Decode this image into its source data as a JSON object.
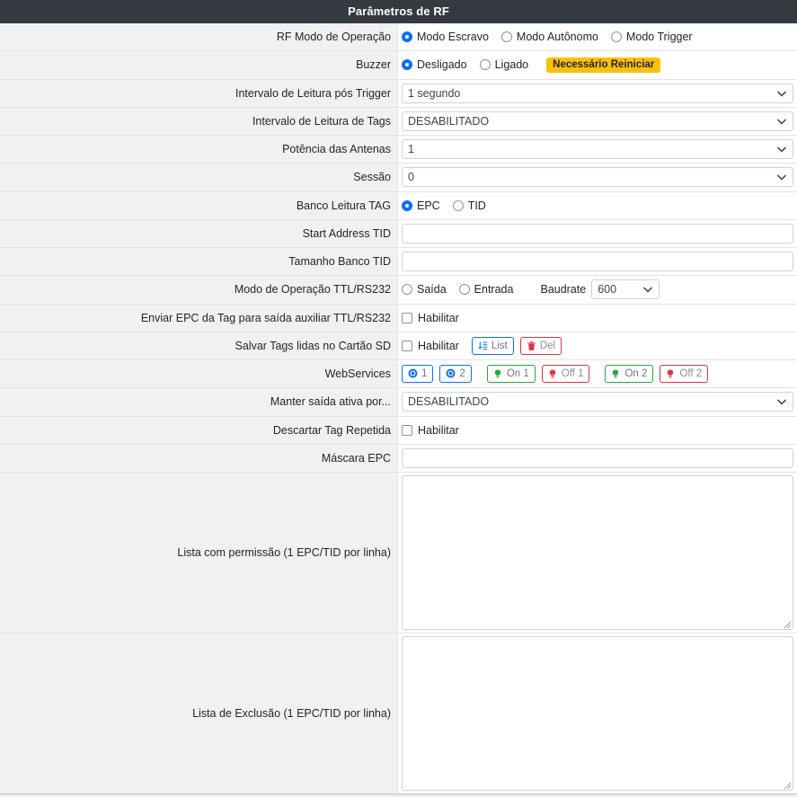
{
  "panel": {
    "title": "Parâmetros de RF",
    "header_bg": "#343a40"
  },
  "colors": {
    "accent_blue": "#0d6efd",
    "danger_red": "#dc3545",
    "success_green": "#28a745",
    "warning_yellow": "#ffc107",
    "label_bg": "#f1f1f2"
  },
  "rows": {
    "rf_mode": {
      "label": "RF Modo de Operação",
      "options": [
        {
          "label": "Modo Escravo",
          "selected": true
        },
        {
          "label": "Modo Autônomo",
          "selected": false
        },
        {
          "label": "Modo Trigger",
          "selected": false
        }
      ]
    },
    "buzzer": {
      "label": "Buzzer",
      "options": [
        {
          "label": "Desligado",
          "selected": true
        },
        {
          "label": "Ligado",
          "selected": false
        }
      ],
      "badge": "Necessário Reiniciar"
    },
    "intervalo_trigger": {
      "label": "Intervalo de Leitura pós Trigger",
      "value": "1 segundo"
    },
    "intervalo_tags": {
      "label": "Intervalo de Leitura de Tags",
      "value": "DESABILITADO"
    },
    "potencia": {
      "label": "Potência das Antenas",
      "value": "1"
    },
    "sessao": {
      "label": "Sessão",
      "value": "0"
    },
    "banco_leitura": {
      "label": "Banco Leitura TAG",
      "options": [
        {
          "label": "EPC",
          "selected": true
        },
        {
          "label": "TID",
          "selected": false
        }
      ]
    },
    "start_address_tid": {
      "label": "Start Address TID",
      "value": "",
      "placeholder": ""
    },
    "tamanho_banco_tid": {
      "label": "Tamanho Banco TID",
      "value": "",
      "placeholder": ""
    },
    "ttl_rs232": {
      "label": "Modo de Operação TTL/RS232",
      "options": [
        {
          "label": "Saída",
          "selected": false
        },
        {
          "label": "Entrada",
          "selected": false
        }
      ],
      "baudrate_label": "Baudrate",
      "baudrate_value": "600"
    },
    "enviar_epc": {
      "label": "Enviar EPC da Tag para saída auxiliar TTL/RS232",
      "checkbox_label": "Habilitar",
      "checked": false
    },
    "salvar_sd": {
      "label": "Salvar Tags lidas no Cartão SD",
      "checkbox_label": "Habilitar",
      "checked": false,
      "buttons": [
        {
          "label": "List",
          "style": "blue",
          "icon": "sort-numeric-icon"
        },
        {
          "label": "Del",
          "style": "red",
          "icon": "trash-icon"
        }
      ]
    },
    "webservices": {
      "label": "WebServices",
      "buttons": [
        {
          "label": "1",
          "style": "blue",
          "icon": "dot-circle-icon"
        },
        {
          "label": "2",
          "style": "blue",
          "icon": "dot-circle-icon"
        },
        {
          "label": "On 1",
          "style": "green",
          "icon": "lightbulb-icon"
        },
        {
          "label": "Off 1",
          "style": "red",
          "icon": "lightbulb-icon"
        },
        {
          "label": "On 2",
          "style": "green",
          "icon": "lightbulb-icon"
        },
        {
          "label": "Off 2",
          "style": "red",
          "icon": "lightbulb-icon"
        }
      ]
    },
    "manter_saida": {
      "label": "Manter saída ativa por...",
      "value": "DESABILITADO"
    },
    "descartar_tag": {
      "label": "Descartar Tag Repetida",
      "checkbox_label": "Habilitar",
      "checked": false
    },
    "mascara_epc": {
      "label": "Máscara EPC",
      "value": "",
      "placeholder": ""
    },
    "lista_permissao": {
      "label": "Lista com permissão (1 EPC/TID por linha)",
      "value": "",
      "placeholder": ""
    },
    "lista_exclusao": {
      "label": "Lista de Exclusão (1 EPC/TID por linha)",
      "value": "",
      "placeholder": ""
    }
  }
}
